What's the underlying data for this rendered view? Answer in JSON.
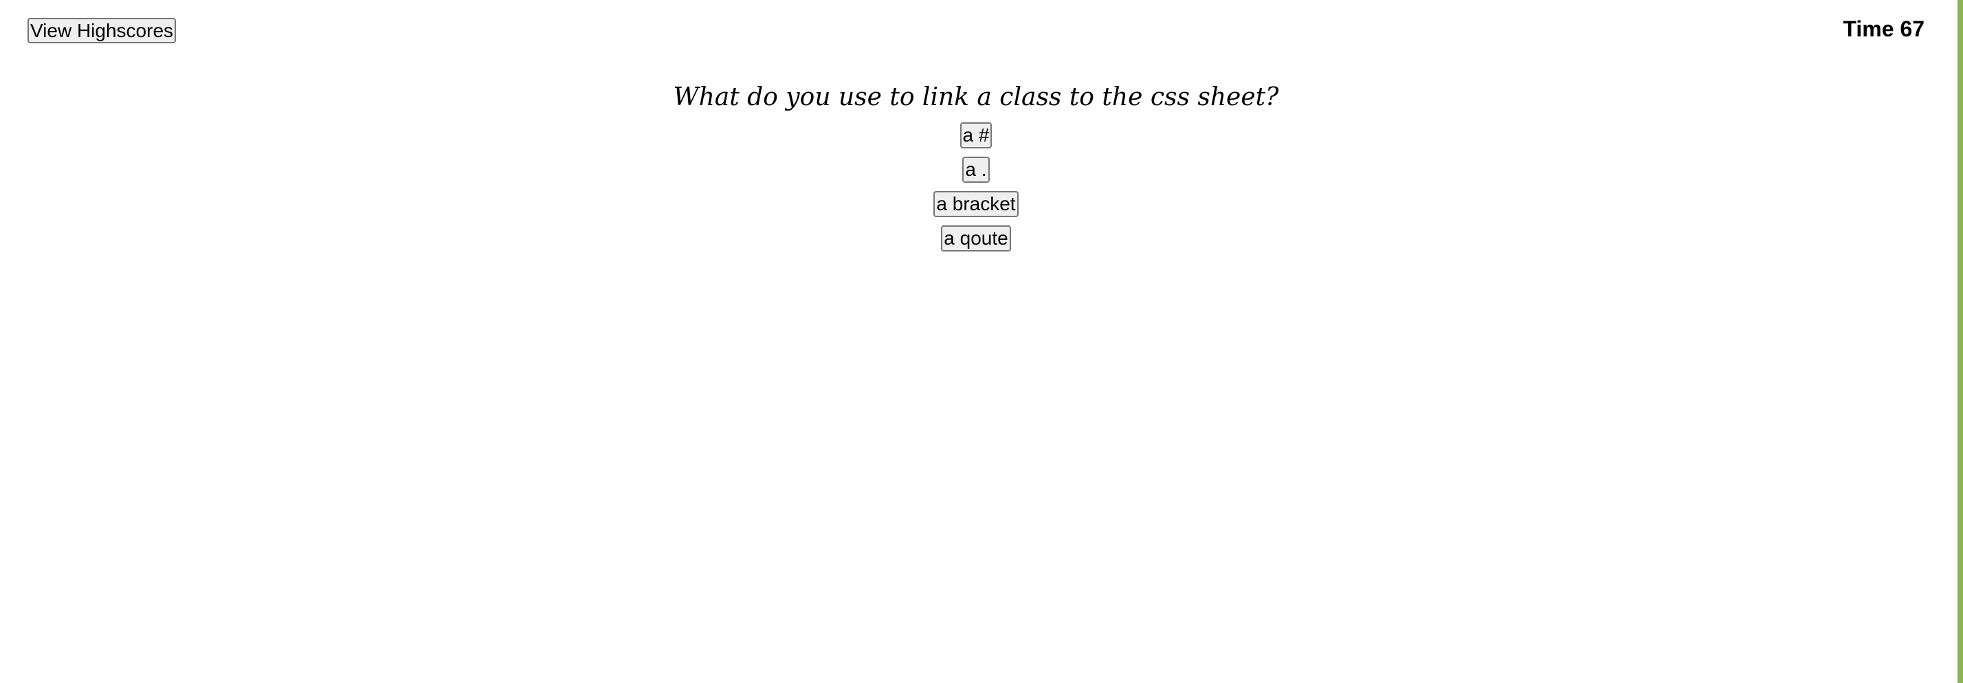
{
  "header": {
    "highscores_label": "View Highscores",
    "timer_text": "Time 67"
  },
  "quiz": {
    "question": "What do you use to link a class to the css sheet?",
    "choices": [
      "a #",
      "a .",
      "a bracket",
      "a qoute"
    ]
  },
  "colors": {
    "accent_bar": "#8cb550",
    "button_bg": "#efefef",
    "button_border": "#767676"
  }
}
